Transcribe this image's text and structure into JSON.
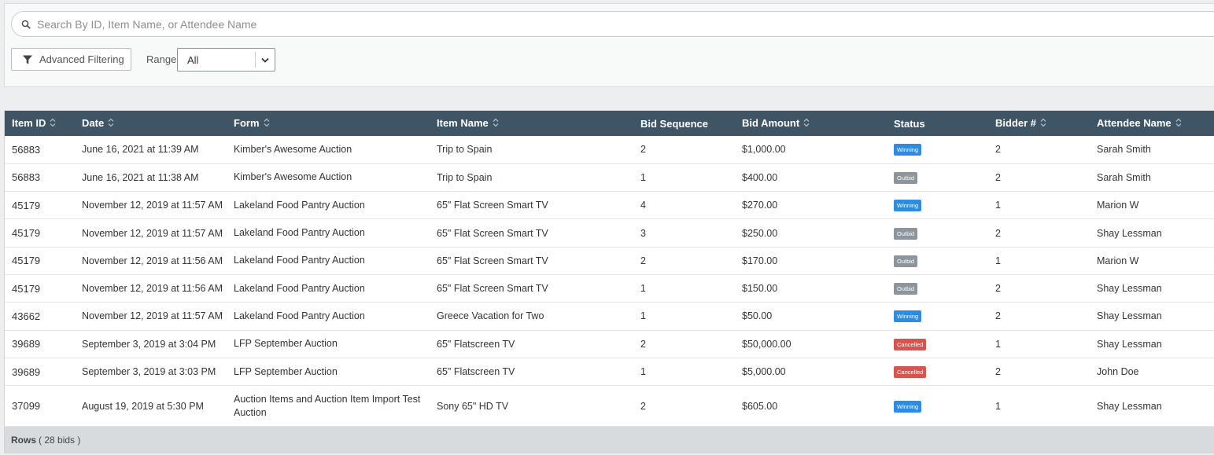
{
  "search": {
    "placeholder": "Search By ID, Item Name, or Attendee Name"
  },
  "filters": {
    "advanced_label": "Advanced Filtering",
    "range_label": "Range",
    "range_value": "All"
  },
  "table": {
    "columns": [
      "Item ID",
      "Date",
      "Form",
      "Item Name",
      "Bid Sequence",
      "Bid Amount",
      "Status",
      "Bidder #",
      "Attendee Name"
    ],
    "rows": [
      {
        "id": "56883",
        "date": "June 16, 2021 at 11:39 AM",
        "form": "Kimber's Awesome Auction",
        "item": "Trip to Spain",
        "seq": "2",
        "amount": "$1,000.00",
        "status": "Winning",
        "bidder": "2",
        "attendee": "Sarah Smith"
      },
      {
        "id": "56883",
        "date": "June 16, 2021 at 11:38 AM",
        "form": "Kimber's Awesome Auction",
        "item": "Trip to Spain",
        "seq": "1",
        "amount": "$400.00",
        "status": "Outbid",
        "bidder": "2",
        "attendee": "Sarah Smith"
      },
      {
        "id": "45179",
        "date": "November 12, 2019 at 11:57 AM",
        "form": "Lakeland Food Pantry Auction",
        "item": "65\" Flat Screen Smart TV",
        "seq": "4",
        "amount": "$270.00",
        "status": "Winning",
        "bidder": "1",
        "attendee": "Marion W"
      },
      {
        "id": "45179",
        "date": "November 12, 2019 at 11:57 AM",
        "form": "Lakeland Food Pantry Auction",
        "item": "65\" Flat Screen Smart TV",
        "seq": "3",
        "amount": "$250.00",
        "status": "Outbid",
        "bidder": "2",
        "attendee": "Shay Lessman"
      },
      {
        "id": "45179",
        "date": "November 12, 2019 at 11:56 AM",
        "form": "Lakeland Food Pantry Auction",
        "item": "65\" Flat Screen Smart TV",
        "seq": "2",
        "amount": "$170.00",
        "status": "Outbid",
        "bidder": "1",
        "attendee": "Marion W"
      },
      {
        "id": "45179",
        "date": "November 12, 2019 at 11:56 AM",
        "form": "Lakeland Food Pantry Auction",
        "item": "65\" Flat Screen Smart TV",
        "seq": "1",
        "amount": "$150.00",
        "status": "Outbid",
        "bidder": "2",
        "attendee": "Shay Lessman"
      },
      {
        "id": "43662",
        "date": "November 12, 2019 at 11:57 AM",
        "form": "Lakeland Food Pantry Auction",
        "item": "Greece Vacation for Two",
        "seq": "1",
        "amount": "$50.00",
        "status": "Winning",
        "bidder": "2",
        "attendee": "Shay Lessman"
      },
      {
        "id": "39689",
        "date": "September 3, 2019 at 3:04 PM",
        "form": "LFP September Auction",
        "item": "65\" Flatscreen TV",
        "seq": "2",
        "amount": "$50,000.00",
        "status": "Cancelled",
        "bidder": "1",
        "attendee": "Shay Lessman"
      },
      {
        "id": "39689",
        "date": "September 3, 2019 at 3:03 PM",
        "form": "LFP September Auction",
        "item": "65\" Flatscreen TV",
        "seq": "1",
        "amount": "$5,000.00",
        "status": "Cancelled",
        "bidder": "2",
        "attendee": "John Doe"
      },
      {
        "id": "37099",
        "date": "August 19, 2019 at 5:30 PM",
        "form": "Auction Items and Auction Item Import Test Auction",
        "item": "Sony 65\" HD TV",
        "seq": "2",
        "amount": "$605.00",
        "status": "Winning",
        "bidder": "1",
        "attendee": "Shay Lessman"
      }
    ]
  },
  "footer": {
    "rows_label": "Rows",
    "count_text": "( 28 bids )"
  },
  "colors": {
    "header_bg": "#3f5464",
    "winning": "#2f8be0",
    "outbid": "#8c959c",
    "cancelled": "#d9534f"
  },
  "icons": {
    "search": "search-icon",
    "filter": "filter-funnel-icon",
    "dropdown": "chevron-down-icon",
    "sort": "sort-arrows-icon"
  }
}
